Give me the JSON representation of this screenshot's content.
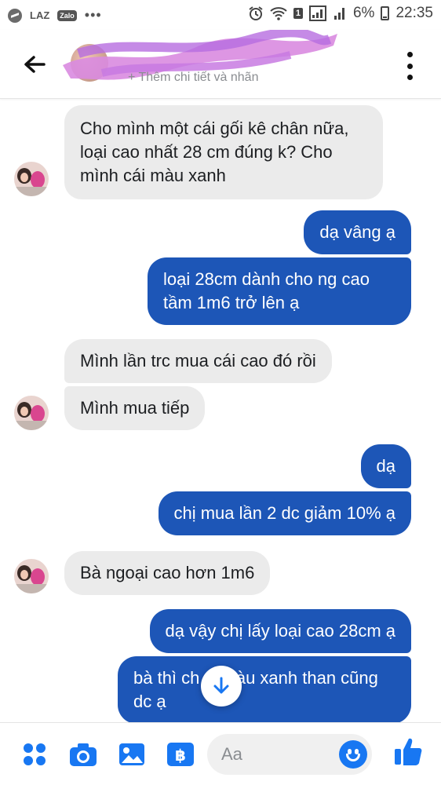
{
  "status_bar": {
    "left_labels": [
      "LAZ",
      "Zalo",
      "•••"
    ],
    "sim_badge": "1",
    "battery": "6%",
    "time": "22:35"
  },
  "header": {
    "subtitle": "+ Thêm chi tiết và nhãn",
    "accent_color": "#1d56b7"
  },
  "messages": [
    {
      "side": "in",
      "text": "Cho mình một cái gối kê chân nữa, loại cao nhất 28 cm đúng k? Cho mình cái màu xanh"
    },
    {
      "side": "out",
      "text": "dạ vâng ạ"
    },
    {
      "side": "out",
      "text": "loại 28cm dành cho ng cao tầm 1m6 trở lên ạ"
    },
    {
      "side": "in",
      "text": "Mình lần trc mua cái cao đó rồi"
    },
    {
      "side": "in",
      "text": "Mình mua tiếp"
    },
    {
      "side": "out",
      "text": "dạ"
    },
    {
      "side": "out",
      "text": "chị mua lần 2 dc giảm 10% ạ"
    },
    {
      "side": "in",
      "text": "Bà ngoại cao hơn 1m6"
    },
    {
      "side": "out",
      "text": "dạ vậy chị lấy loại cao 28cm ạ"
    },
    {
      "side": "out",
      "text": "bà thì ch… màu xanh than cũng dc ạ"
    }
  ],
  "composer": {
    "placeholder": "Aa",
    "icons": [
      "menu-icon",
      "camera-icon",
      "gallery-icon",
      "payment-icon",
      "emoji-icon",
      "like-icon"
    ]
  }
}
